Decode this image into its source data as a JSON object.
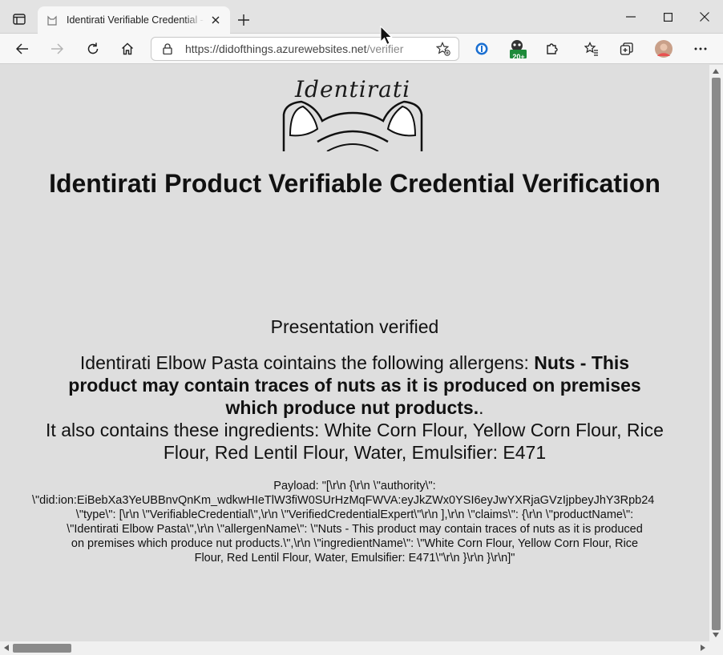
{
  "browser": {
    "tab_title": "Identirati Verifiable Credential - V",
    "url_host": "https://didofthings.azurewebsites.net",
    "url_path": "/verifier",
    "extension_badge": "20+"
  },
  "page": {
    "logo_text": "Identirati",
    "title": "Identirati Product Verifiable Credential Verification",
    "status": "Presentation verified",
    "allergen_prefix": "Identirati Elbow Pasta cointains the following allergens: ",
    "allergen_bold": "Nuts - This product may contain traces of nuts as it is produced on premises which produce nut products.",
    "allergen_suffix": ".",
    "ingredients_line": "It also contains these ingredients: White Corn Flour, Yellow Corn Flour, Rice Flour, Red Lentil Flour, Water, Emulsifier: E471",
    "payload_lines": [
      "Payload: \"[\\r\\n {\\r\\n \\\"authority\\\":",
      "\\\"did:ion:EiBebXa3YeUBBnvQnKm_wdkwHIeTlW3fiW0SUrHzMqFWVA:eyJkZWx0YSI6eyJwYXRjaGVzIjpbeyJhY3Rpb24",
      "\\\"type\\\": [\\r\\n \\\"VerifiableCredential\\\",\\r\\n \\\"VerifiedCredentialExpert\\\"\\r\\n ],\\r\\n \\\"claims\\\": {\\r\\n \\\"productName\\\":",
      "\\\"Identirati Elbow Pasta\\\",\\r\\n \\\"allergenName\\\": \\\"Nuts - This product may contain traces of nuts as it is produced",
      "on premises which produce nut products.\\\",\\r\\n \\\"ingredientName\\\": \\\"White Corn Flour, Yellow Corn Flour, Rice",
      "Flour, Red Lentil Flour, Water, Emulsifier: E471\\\"\\r\\n }\\r\\n }\\r\\n]\""
    ]
  },
  "colors": {
    "page_bg": "#dedede",
    "chrome_bg": "#e3e3e3",
    "toolbar_bg": "#f7f7f7",
    "badge_green": "#1d8a3a"
  }
}
